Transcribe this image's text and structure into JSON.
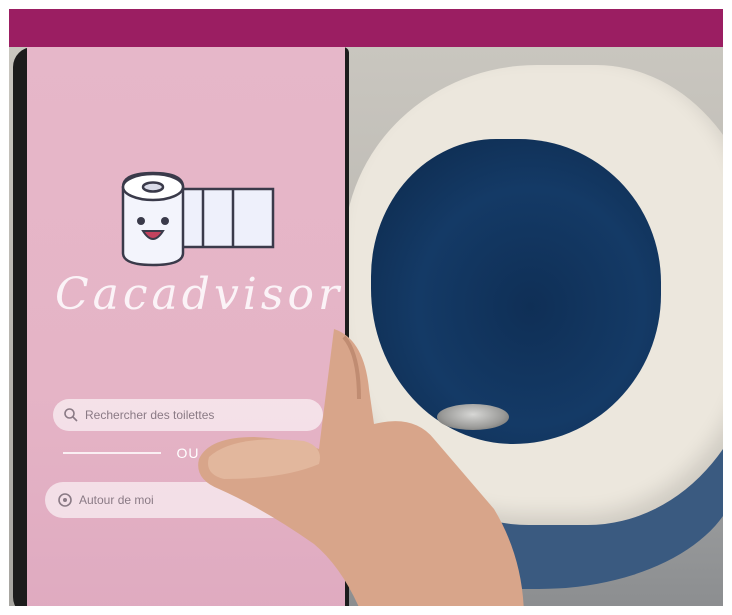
{
  "colors": {
    "banner": "#9b1e62",
    "screen_pink": "#e6b7c9",
    "toilet_bowl": "#143a66",
    "toilet_seat": "#ece7dd",
    "skin": "#d8a58a"
  },
  "app": {
    "title": "Cacadvisor",
    "search_placeholder": "Rechercher des toilettes",
    "search_icon": "search-icon",
    "or_label": "OU",
    "location_label": "Autour de moi",
    "location_icon": "location-icon",
    "logo": "toilet-paper-roll-logo"
  }
}
